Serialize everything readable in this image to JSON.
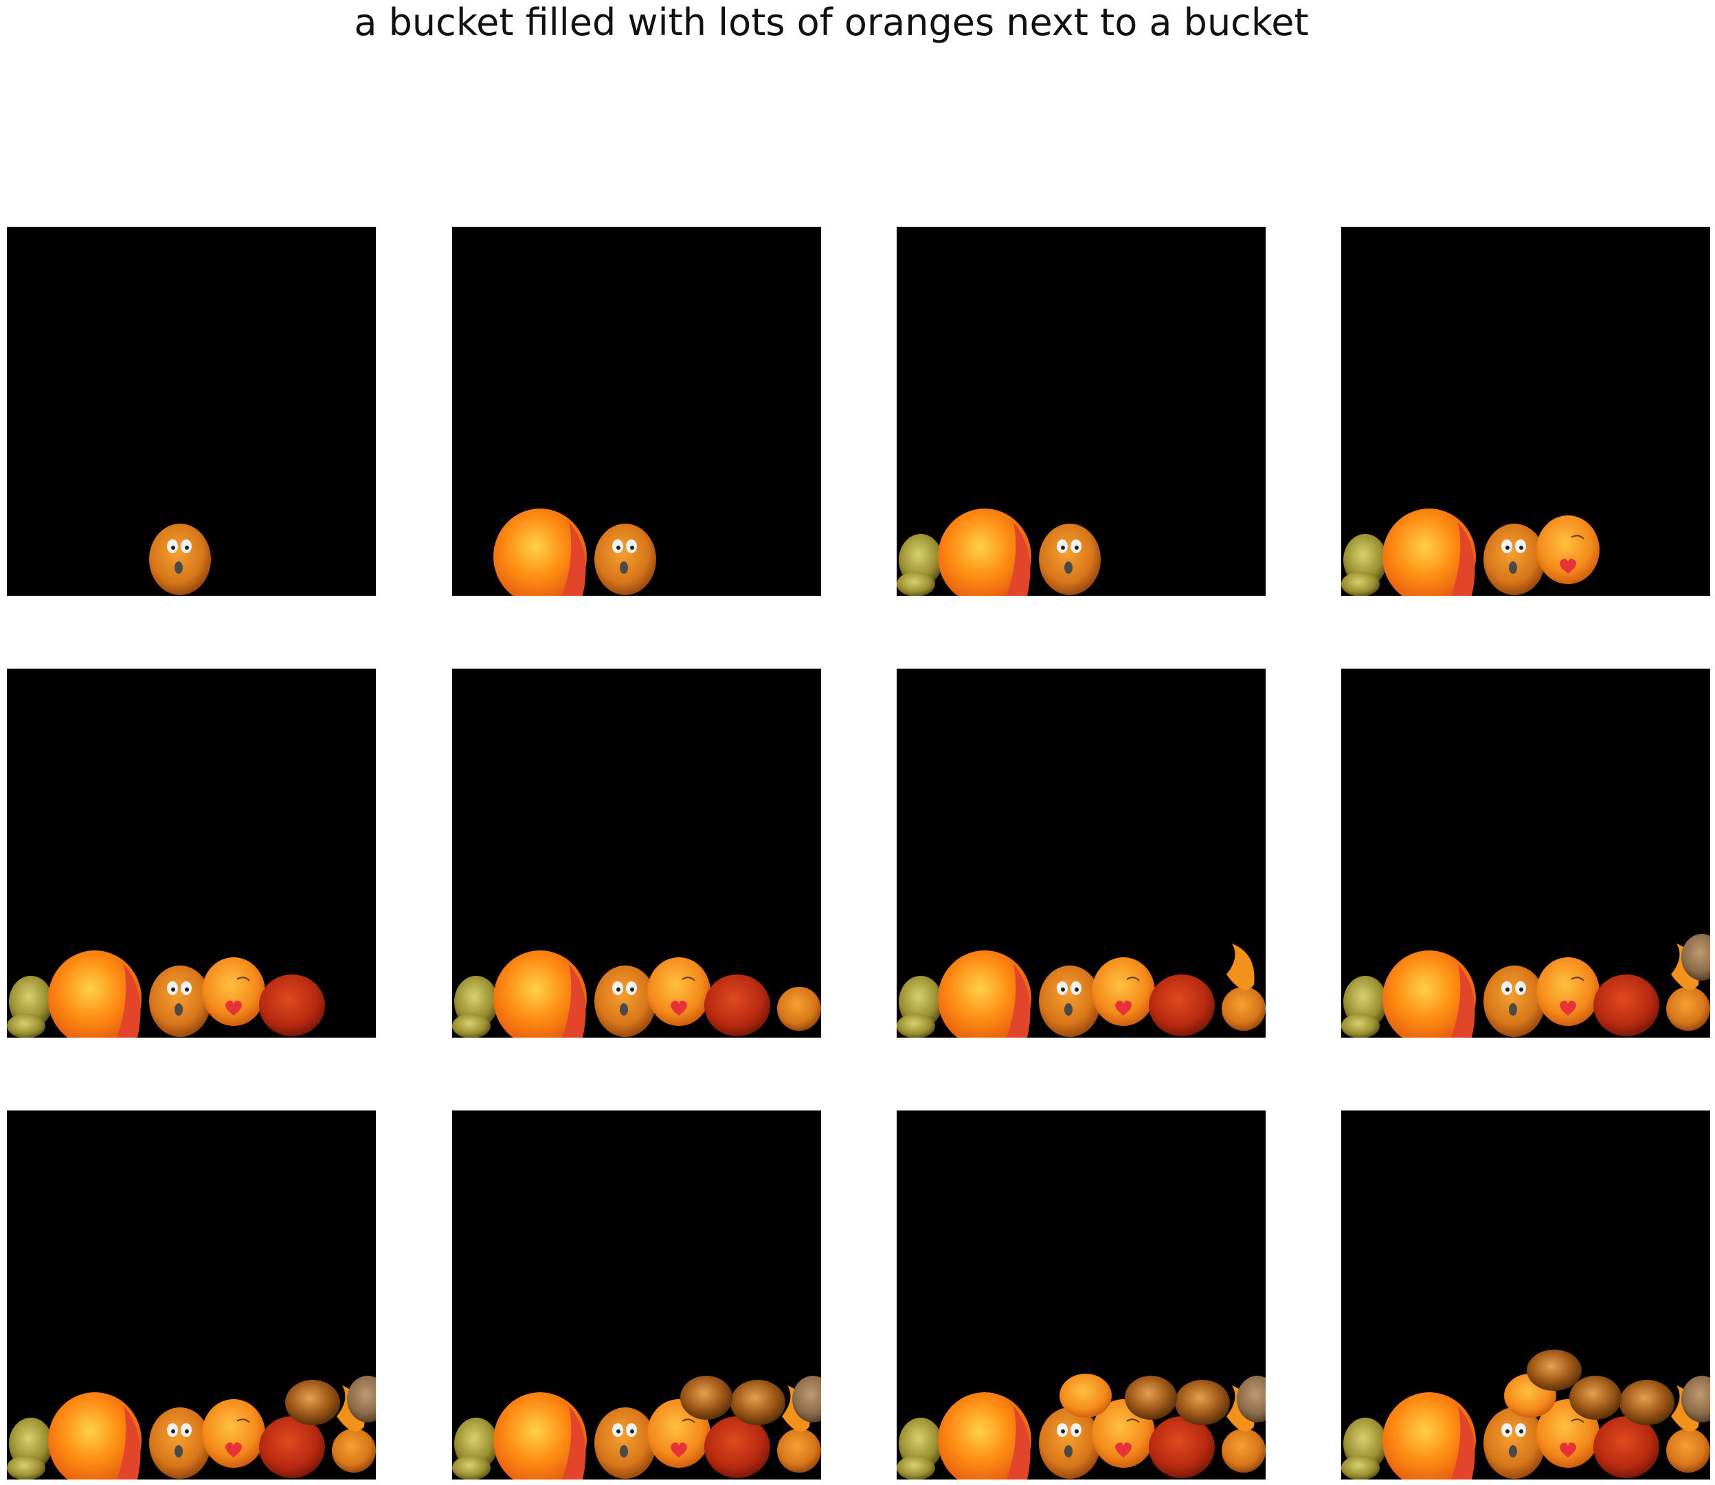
{
  "title": "a bucket filled with lots of oranges next to a bucket",
  "colors": {
    "background": "#ffffff",
    "panel": "#000000"
  },
  "panels": [
    {
      "step": 1,
      "objects": [
        "orange-face"
      ]
    },
    {
      "step": 2,
      "objects": [
        "big-orange",
        "orange-face"
      ]
    },
    {
      "step": 3,
      "objects": [
        "green-fruit",
        "big-orange",
        "orange-face"
      ]
    },
    {
      "step": 4,
      "objects": [
        "green-fruit",
        "big-orange",
        "orange-face",
        "orange-heart"
      ]
    },
    {
      "step": 5,
      "objects": [
        "green-fruit",
        "big-orange",
        "orange-face",
        "orange-heart",
        "red-fruit"
      ]
    },
    {
      "step": 6,
      "objects": [
        "green-fruit",
        "big-orange",
        "orange-face",
        "orange-heart",
        "red-fruit",
        "small-orange"
      ]
    },
    {
      "step": 7,
      "objects": [
        "green-fruit",
        "big-orange",
        "orange-face",
        "orange-heart",
        "red-fruit",
        "small-orange",
        "orange-peel"
      ]
    },
    {
      "step": 8,
      "objects": [
        "green-fruit",
        "big-orange",
        "orange-face",
        "orange-heart",
        "red-fruit",
        "small-orange",
        "orange-peel",
        "brown-fruit"
      ]
    },
    {
      "step": 9,
      "objects": [
        "green-fruit",
        "big-orange",
        "orange-face",
        "orange-heart",
        "red-fruit",
        "small-orange",
        "orange-peel",
        "brown-fruit",
        "brown-orange-1"
      ]
    },
    {
      "step": 10,
      "objects": [
        "green-fruit",
        "big-orange",
        "orange-face",
        "orange-heart",
        "red-fruit",
        "small-orange",
        "orange-peel",
        "brown-fruit",
        "brown-orange-1",
        "brown-orange-2"
      ]
    },
    {
      "step": 11,
      "objects": [
        "green-fruit",
        "big-orange",
        "orange-face",
        "orange-heart",
        "red-fruit",
        "small-orange",
        "orange-peel",
        "brown-fruit",
        "brown-orange-1",
        "brown-orange-2",
        "top-orange"
      ]
    },
    {
      "step": 12,
      "objects": [
        "green-fruit",
        "big-orange",
        "orange-face",
        "orange-heart",
        "red-fruit",
        "small-orange",
        "orange-peel",
        "brown-fruit",
        "brown-orange-1",
        "brown-orange-2",
        "top-orange",
        "brown-orange-3"
      ]
    }
  ]
}
